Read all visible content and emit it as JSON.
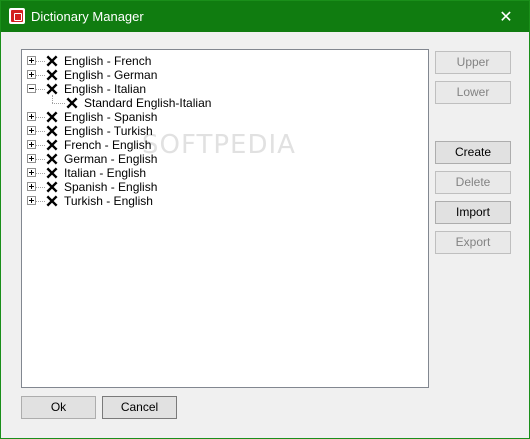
{
  "window": {
    "title": "Dictionary Manager",
    "close_glyph": "✕",
    "accent_color": "#107c10"
  },
  "tree": {
    "items": [
      {
        "label": "English - French",
        "expanded": false,
        "checked": true
      },
      {
        "label": "English - German",
        "expanded": false,
        "checked": true
      },
      {
        "label": "English - Italian",
        "expanded": true,
        "checked": true,
        "children": [
          {
            "label": "Standard English-Italian",
            "checked": true
          }
        ]
      },
      {
        "label": "English - Spanish",
        "expanded": false,
        "checked": true
      },
      {
        "label": "English - Turkish",
        "expanded": false,
        "checked": true
      },
      {
        "label": "French - English",
        "expanded": false,
        "checked": true
      },
      {
        "label": "German - English",
        "expanded": false,
        "checked": true
      },
      {
        "label": "Italian - English",
        "expanded": false,
        "checked": true
      },
      {
        "label": "Spanish - English",
        "expanded": false,
        "checked": true
      },
      {
        "label": "Turkish - English",
        "expanded": false,
        "checked": true
      }
    ]
  },
  "buttons": {
    "upper": {
      "label": "Upper",
      "enabled": false
    },
    "lower": {
      "label": "Lower",
      "enabled": false
    },
    "create": {
      "label": "Create",
      "enabled": true
    },
    "delete": {
      "label": "Delete",
      "enabled": false
    },
    "import": {
      "label": "Import",
      "enabled": true
    },
    "export": {
      "label": "Export",
      "enabled": false
    },
    "ok": {
      "label": "Ok",
      "enabled": true
    },
    "cancel": {
      "label": "Cancel",
      "enabled": true
    }
  },
  "icons": {
    "app": "app-icon",
    "close": "close-icon",
    "check": "checkbox-x-icon",
    "expander": "tree-expander-icon"
  },
  "watermark": "SOFTPEDIA"
}
